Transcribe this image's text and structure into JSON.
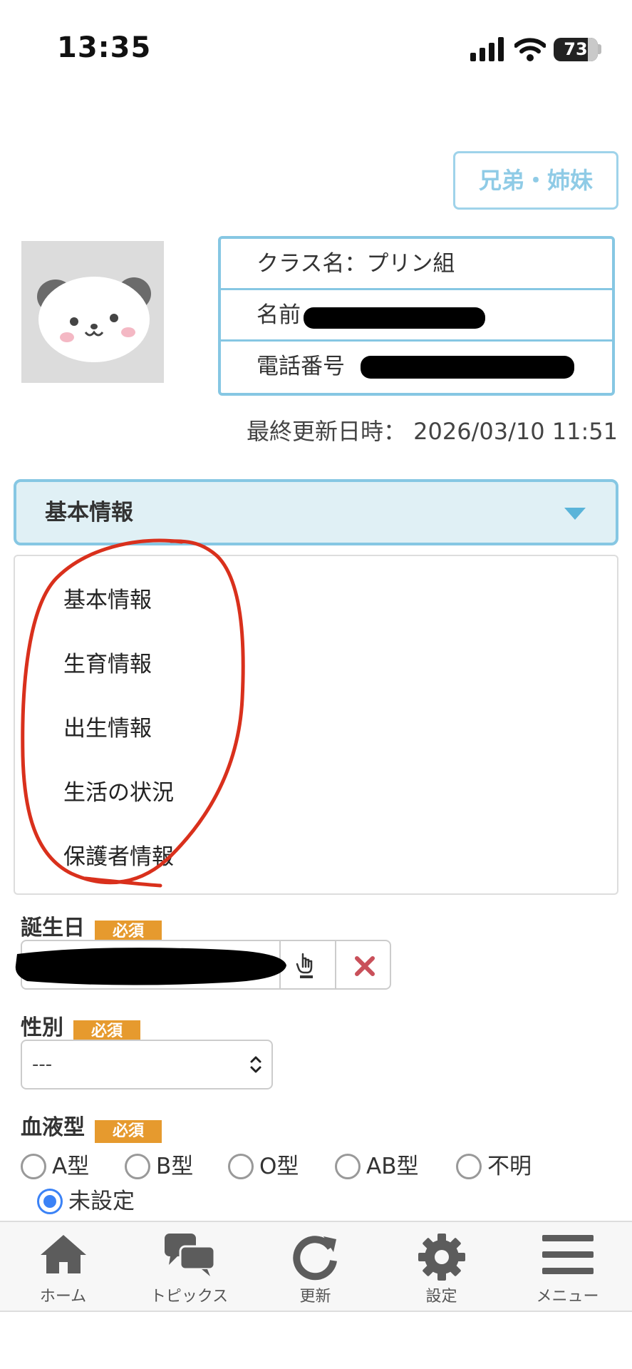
{
  "status_bar": {
    "time": "13:35",
    "battery": "73"
  },
  "sibling_button": "兄弟・姉妹",
  "child_info": {
    "class_row": "クラス名：プリン組",
    "name_label": "名前",
    "phone_label": "電話番号"
  },
  "last_updated": "最終更新日時： 2026/03/10 11:51",
  "section_select": {
    "selected": "基本情報"
  },
  "section_options": [
    "基本情報",
    "生育情報",
    "出生情報",
    "生活の状況",
    "保護者情報"
  ],
  "fields": {
    "birthday": {
      "label": "誕生日",
      "required": "必須"
    },
    "gender": {
      "label": "性別",
      "required": "必須",
      "value": "---"
    },
    "blood_type": {
      "label": "血液型",
      "required": "必須",
      "options": [
        "A型",
        "B型",
        "O型",
        "AB型",
        "不明",
        "未設定"
      ],
      "selected": "未設定"
    }
  },
  "tabbar": [
    "ホーム",
    "トピックス",
    "更新",
    "設定",
    "メニュー"
  ],
  "colors": {
    "accent": "#86c7e3",
    "required": "#e69a2e",
    "radio_selected": "#3b82f6",
    "annotation": "#d9301c"
  }
}
